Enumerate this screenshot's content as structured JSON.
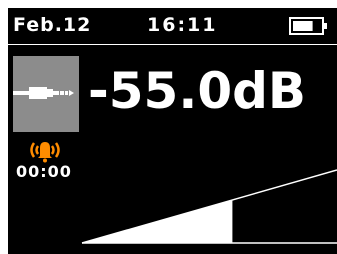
{
  "status_bar": {
    "date": "Feb.12",
    "time": "16:11",
    "battery_icon": "battery-icon",
    "battery_level": 0.7
  },
  "source": {
    "icon": "audio-cable-icon"
  },
  "level_display": {
    "value": "-55.0dB"
  },
  "alarm": {
    "icon": "alarm-bell-icon",
    "time": "00:00",
    "color": "#ff8c00"
  },
  "meter": {
    "icon": "level-meter-icon",
    "fill_fraction": 0.59
  },
  "colors": {
    "background": "#000000",
    "foreground": "#ffffff",
    "tile": "#8c8c8c",
    "accent": "#ff8c00"
  }
}
